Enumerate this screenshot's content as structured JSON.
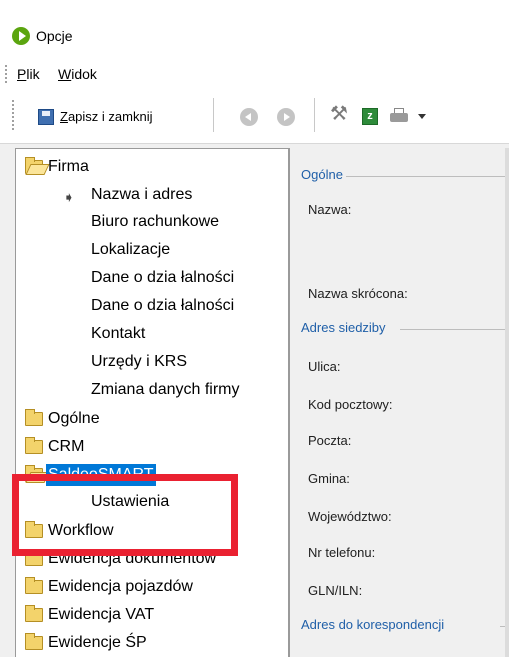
{
  "window": {
    "title": "Opcje"
  },
  "menu": {
    "file": "Plik",
    "view": "Widok"
  },
  "toolbar": {
    "save_close": "Zapisz i zamknij",
    "excel_glyph": "z"
  },
  "tree": {
    "items": [
      {
        "label": "Firma",
        "type": "folder-open",
        "selected": false
      },
      {
        "label": "Nazwa i adres",
        "type": "current",
        "selected": false
      },
      {
        "label": "Biuro rachunkowe",
        "type": "child",
        "selected": false
      },
      {
        "label": "Lokalizacje",
        "type": "child",
        "selected": false
      },
      {
        "label": "Dane o dzia łalności",
        "type": "child",
        "selected": false
      },
      {
        "label": "Dane o dzia łalności",
        "type": "child",
        "selected": false
      },
      {
        "label": "Kontakt",
        "type": "child",
        "selected": false
      },
      {
        "label": "Urzędy i KRS",
        "type": "child",
        "selected": false
      },
      {
        "label": "Zmiana danych firmy",
        "type": "child",
        "selected": false
      },
      {
        "label": "Ogólne",
        "type": "folder",
        "selected": false
      },
      {
        "label": "CRM",
        "type": "folder",
        "selected": false
      },
      {
        "label": "SaldeoSMART",
        "type": "folder-open",
        "selected": true
      },
      {
        "label": "Ustawienia",
        "type": "child",
        "selected": false
      },
      {
        "label": "Workflow",
        "type": "folder",
        "selected": false
      },
      {
        "label": "Ewidencja dokumentów",
        "type": "folder",
        "selected": false
      },
      {
        "label": "Ewidencja pojazdów",
        "type": "folder",
        "selected": false
      },
      {
        "label": "Ewidencja VAT",
        "type": "folder",
        "selected": false
      },
      {
        "label": "Ewidencje ŚP",
        "type": "folder",
        "selected": false
      }
    ]
  },
  "form": {
    "section_general": "Ogólne",
    "name": "Nazwa:",
    "short_name": "Nazwa skrócona:",
    "section_address": "Adres siedziby",
    "street": "Ulica:",
    "postal_code": "Kod pocztowy:",
    "post_office": "Poczta:",
    "municipality": "Gmina:",
    "voivodeship": "Województwo:",
    "phone": "Nr telefonu:",
    "gln": "GLN/ILN:",
    "section_correspondence": "Adres do korespondencji"
  },
  "colors": {
    "highlight": "#ea2131",
    "selection": "#0078d7",
    "section_header": "#1f5fa8"
  }
}
